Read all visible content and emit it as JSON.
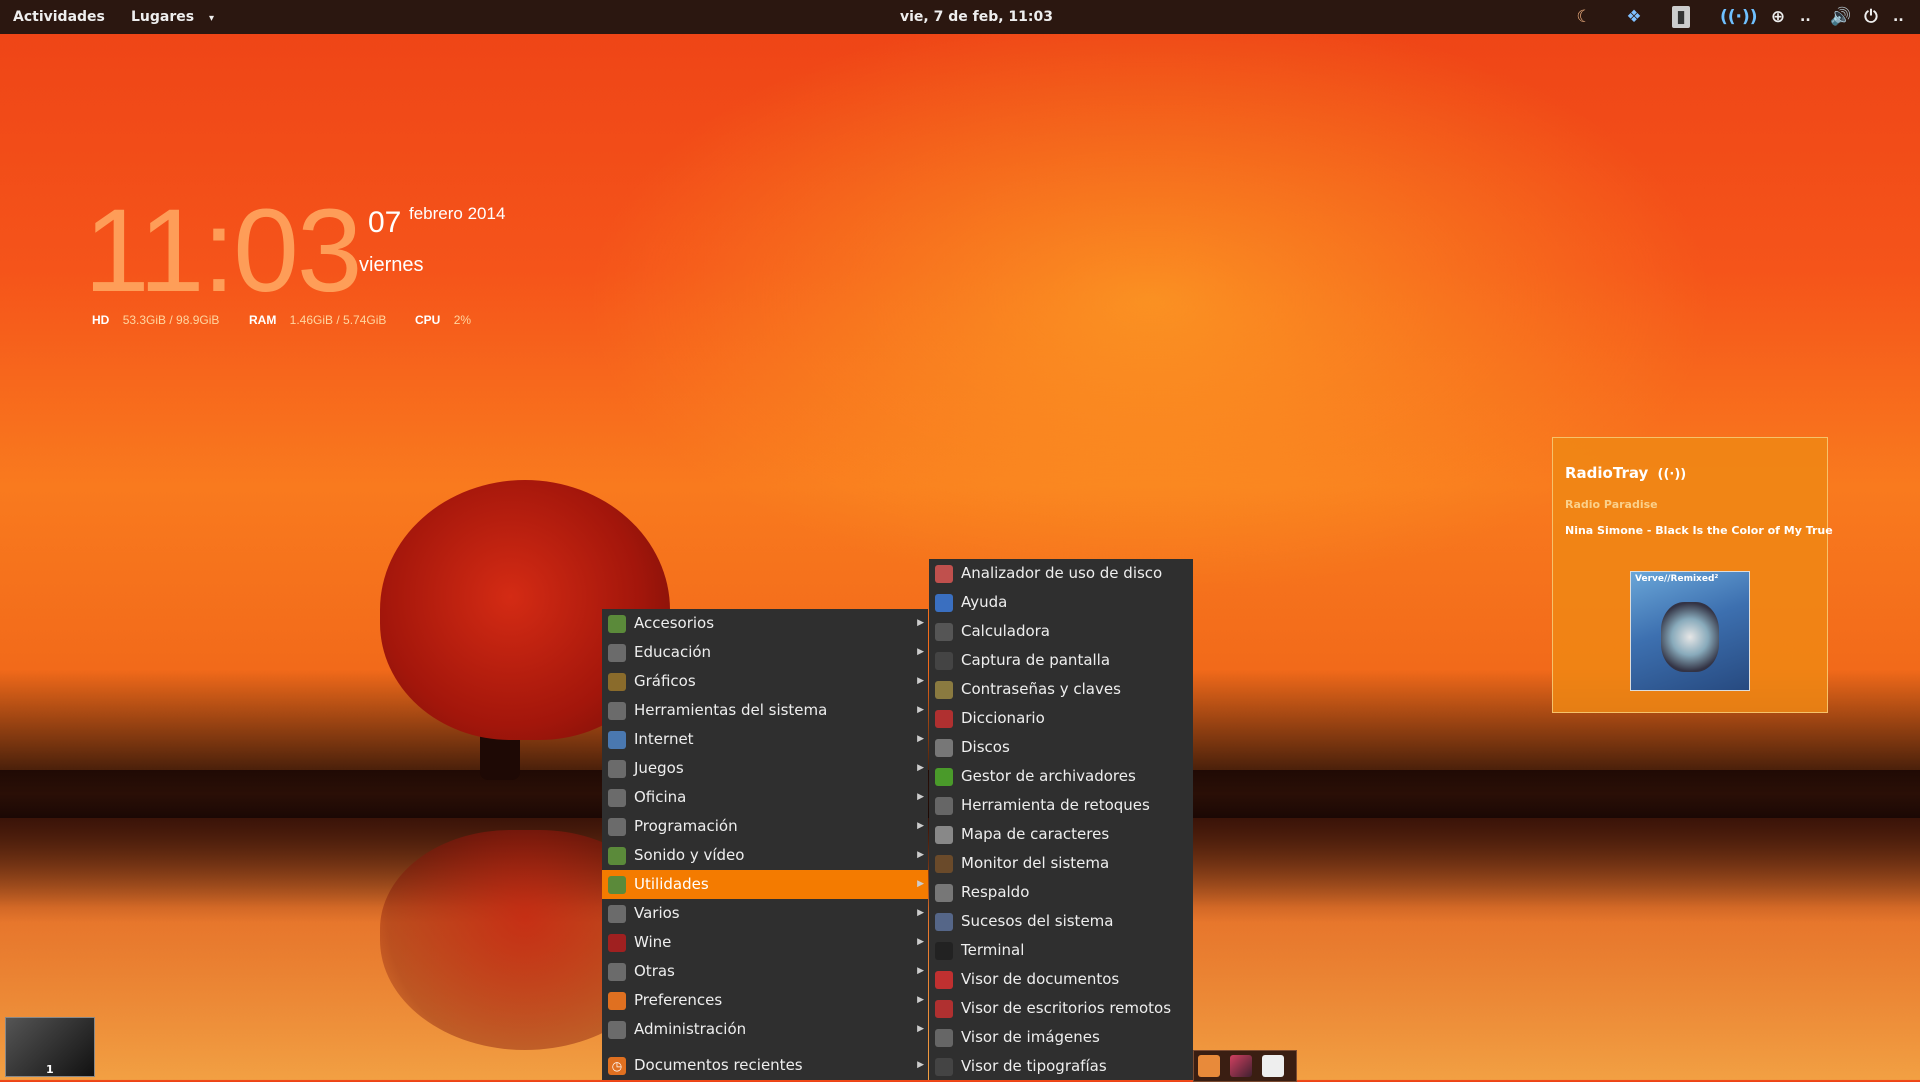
{
  "topbar": {
    "activities": "Actividades",
    "places": "Lugares",
    "places_arrow": "▾",
    "clock": "vie,  7 de feb, 11:03",
    "overflow_mid": "..",
    "overflow_end": "..",
    "tray_icons": [
      "moon-icon",
      "dropbox-icon",
      "contact-card-icon",
      "radio-signal-icon",
      "accessibility-icon",
      "volume-icon",
      "power-icon"
    ]
  },
  "conky": {
    "time": "11:03",
    "day": "07",
    "month_year": "febrero 2014",
    "weekday": "viernes",
    "hd_label": "HD",
    "hd_value": "53.3GiB / 98.9GiB",
    "ram_label": "RAM",
    "ram_value": "1.46GiB / 5.74GiB",
    "cpu_label": "CPU",
    "cpu_value": "2%"
  },
  "workspace": {
    "number": "1"
  },
  "main_menu": {
    "items": [
      {
        "label": "Accesorios",
        "icon": "accessories-icon",
        "color": "#5b8a3a"
      },
      {
        "label": "Educación",
        "icon": "education-icon",
        "color": "#6b6b6b"
      },
      {
        "label": "Gráficos",
        "icon": "graphics-icon",
        "color": "#8a6b2b"
      },
      {
        "label": "Herramientas del sistema",
        "icon": "system-tools-icon",
        "color": "#6b6b6b"
      },
      {
        "label": "Internet",
        "icon": "internet-icon",
        "color": "#4a78b0"
      },
      {
        "label": "Juegos",
        "icon": "games-icon",
        "color": "#6b6b6b"
      },
      {
        "label": "Oficina",
        "icon": "office-icon",
        "color": "#6b6b6b"
      },
      {
        "label": "Programación",
        "icon": "programming-icon",
        "color": "#6b6b6b"
      },
      {
        "label": "Sonido y vídeo",
        "icon": "sound-video-icon",
        "color": "#5b8a3a"
      },
      {
        "label": "Utilidades",
        "icon": "utilities-icon",
        "color": "#5b8a3a"
      },
      {
        "label": "Varios",
        "icon": "misc-icon",
        "color": "#6b6b6b"
      },
      {
        "label": "Wine",
        "icon": "wine-icon",
        "color": "#a02020"
      },
      {
        "label": "Otras",
        "icon": "other-icon",
        "color": "#6b6b6b"
      },
      {
        "label": "Preferences",
        "icon": "preferences-icon",
        "color": "#e07020"
      },
      {
        "label": "Administración",
        "icon": "administration-icon",
        "color": "#6b6b6b"
      }
    ],
    "recent": {
      "label": "Documentos recientes",
      "icon": "recent-documents-icon",
      "color": "#e07020"
    },
    "arrow": "▶"
  },
  "sub_menu": {
    "items": [
      {
        "label": "Analizador de uso de disco",
        "icon": "disk-usage-icon",
        "color": "#c0504d"
      },
      {
        "label": "Ayuda",
        "icon": "help-icon",
        "color": "#3a6fc0"
      },
      {
        "label": "Calculadora",
        "icon": "calculator-icon",
        "color": "#555555"
      },
      {
        "label": "Captura de pantalla",
        "icon": "screenshot-icon",
        "color": "#444444"
      },
      {
        "label": "Contraseñas y claves",
        "icon": "passwords-icon",
        "color": "#8a7a40"
      },
      {
        "label": "Diccionario",
        "icon": "dictionary-icon",
        "color": "#b03030"
      },
      {
        "label": "Discos",
        "icon": "disks-icon",
        "color": "#777777"
      },
      {
        "label": "Gestor de archivadores",
        "icon": "archive-manager-icon",
        "color": "#4a9a2a"
      },
      {
        "label": "Herramienta de retoques",
        "icon": "tweak-tool-icon",
        "color": "#666666"
      },
      {
        "label": "Mapa de caracteres",
        "icon": "character-map-icon",
        "color": "#888888"
      },
      {
        "label": "Monitor del sistema",
        "icon": "system-monitor-icon",
        "color": "#6a4a2a"
      },
      {
        "label": "Respaldo",
        "icon": "backup-icon",
        "color": "#777777"
      },
      {
        "label": "Sucesos del sistema",
        "icon": "system-log-icon",
        "color": "#556688"
      },
      {
        "label": "Terminal",
        "icon": "terminal-icon",
        "color": "#222222"
      },
      {
        "label": "Visor de documentos",
        "icon": "document-viewer-icon",
        "color": "#c03030"
      },
      {
        "label": "Visor de escritorios remotos",
        "icon": "remote-desktop-icon",
        "color": "#b03030"
      },
      {
        "label": "Visor de imágenes",
        "icon": "image-viewer-icon",
        "color": "#666666"
      },
      {
        "label": "Visor de tipografías",
        "icon": "font-viewer-icon",
        "color": "#444444"
      }
    ]
  },
  "radiotray": {
    "title": "RadioTray",
    "station": "Radio Paradise",
    "song": "Nina Simone - Black Is the Color of My True",
    "cover_label": "Verve//Remixed²"
  },
  "colors": {
    "accent": "#f47b00",
    "menu_bg": "#2f2f2f",
    "topbar_bg": "#2b1710"
  }
}
